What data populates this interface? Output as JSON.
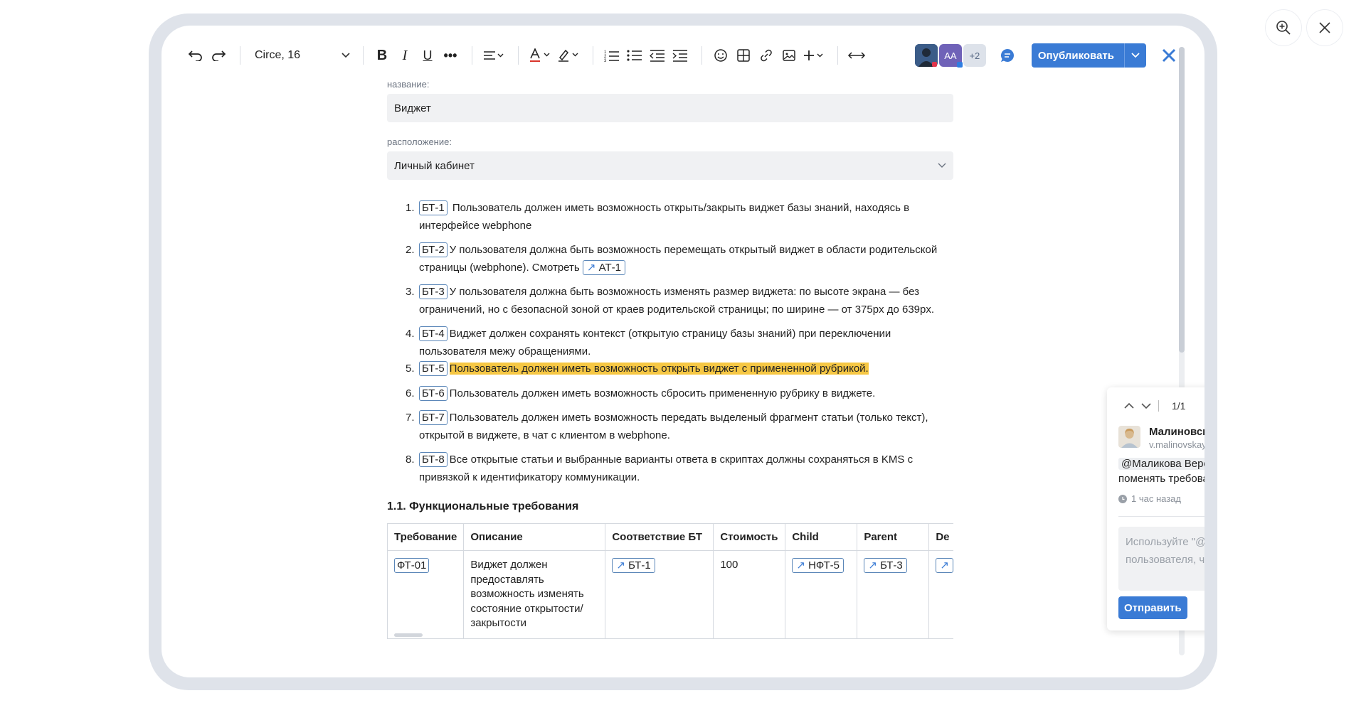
{
  "toolbar": {
    "font": "Circe, 16",
    "avatar_initials": "AA",
    "avatar_more": "+2",
    "publish_label": "Опубликовать"
  },
  "form": {
    "name_label": "название:",
    "name_value": "Виджет",
    "location_label": "расположение:",
    "location_value": "Личный кабинет"
  },
  "requirements": [
    {
      "num": "1.",
      "tag": "БТ-1",
      "text": "Пользователь должен иметь возможность открыть/закрыть виджет базы знаний, находясь в интерфейсе webphone"
    },
    {
      "num": "2.",
      "tag": "БТ-2",
      "text": "У пользователя должна быть возможность перемещать открытый виджет в области родительской страницы (webphone). Смотреть",
      "link": "АТ-1"
    },
    {
      "num": "3.",
      "tag": "БТ-3",
      "text": "У пользователя должна быть возможность изменять размер виджета: по высоте экрана — без ограничений, но с безопасной зоной от краев родительской страницы; по ширине — от 375px до 639px."
    },
    {
      "num": "4.",
      "tag": "БТ-4",
      "text": "Виджет должен сохранять контекст (открытую страницу базы знаний) при переключении пользователя межу обращениями."
    },
    {
      "num": "5.",
      "tag": "БТ-5",
      "text": "Пользователь должен иметь возможность открыть виджет с примененной рубрикой."
    },
    {
      "num": "6.",
      "tag": "БТ-6",
      "text": "Пользователь должен иметь возможность сбросить примененную рубрику в виджете."
    },
    {
      "num": "7.",
      "tag": "БТ-7",
      "text": "Пользователь должен иметь возможность передать выделеный фрагмент статьи (только текст), открытой в виджете, в чат с клиентом в webphone."
    },
    {
      "num": "8.",
      "tag": "БТ-8",
      "text": "Все открытые статьи и выбранные варианты ответа в скриптах должны сохраняться в KMS с привязкой к идентификатору коммуникации."
    }
  ],
  "section_title": "1.1. Функциональные требования",
  "table": {
    "headers": [
      "Требование",
      "Описание",
      "Соответствие БТ",
      "Стоимость",
      "Child",
      "Parent",
      "De"
    ],
    "row": {
      "id": "ФТ-01",
      "description": "Виджет должен предоставлять возможность изменять состояние открытости/закрытости",
      "bt": "БТ-1",
      "cost": "100",
      "child": "НФТ-5",
      "parent": "БТ-3"
    }
  },
  "comment": {
    "counter": "1/1",
    "author": "Малиновская Вера",
    "username": "v.malinovskay",
    "mention": "@Маликова Вероника",
    "text": "необходимо поменять требование.",
    "time": "1 час назад",
    "placeholder": "Используйте \"@\" перед именем пользователя, чтобы уведомить его.",
    "send_label": "Отправить"
  },
  "colors": {
    "accent": "#3a7bd5",
    "highlight": "#f6c744",
    "tag_border": "#5a86b8"
  }
}
